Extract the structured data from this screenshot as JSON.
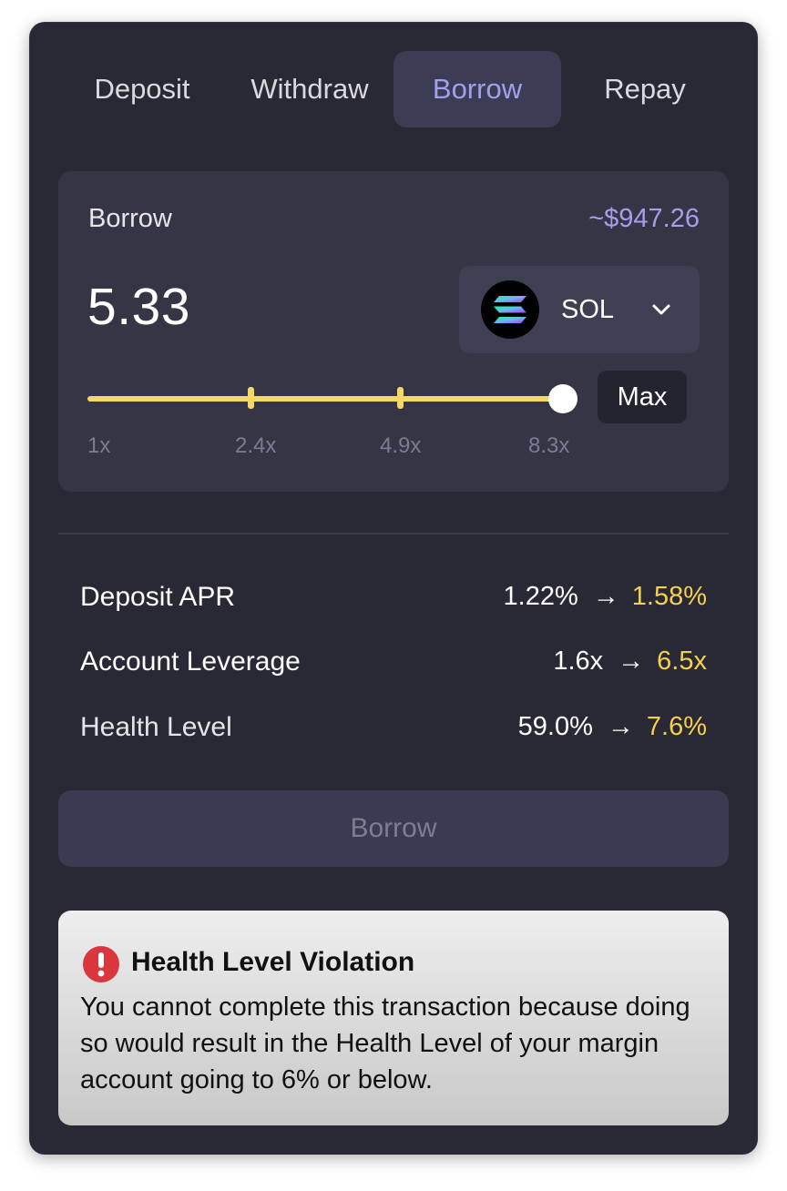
{
  "tabs": [
    {
      "label": "Deposit"
    },
    {
      "label": "Withdraw"
    },
    {
      "label": "Borrow",
      "active": true
    },
    {
      "label": "Repay"
    }
  ],
  "panel": {
    "label": "Borrow",
    "usd_value": "~$947.26",
    "amount": "5.33",
    "token": {
      "symbol": "SOL",
      "icon": "solana-logo-icon"
    },
    "max_label": "Max",
    "slider": {
      "value_fraction": 1.0,
      "tick_labels": [
        "1x",
        "2.4x",
        "4.9x",
        "8.3x"
      ]
    }
  },
  "stats": [
    {
      "label": "Deposit APR",
      "from": "1.22%",
      "arrow": "→",
      "to": "1.58%"
    },
    {
      "label": "Account Leverage",
      "from": "1.6x",
      "arrow": "→",
      "to": "6.5x"
    },
    {
      "label": "Health Level",
      "from": "59.0%",
      "arrow": "→",
      "to": "7.6%"
    }
  ],
  "action": {
    "label": "Borrow",
    "disabled": true
  },
  "alert": {
    "icon": "exclamation-circle-icon",
    "title": "Health Level Violation",
    "body": "You cannot complete this transaction because doing so would result in the Health Level of your margin account going to 6% or below."
  },
  "colors": {
    "background": "#292935",
    "accent": "#a49eec",
    "highlight": "#f6d04d",
    "slider": "#f3d767",
    "error": "#d9363e"
  }
}
